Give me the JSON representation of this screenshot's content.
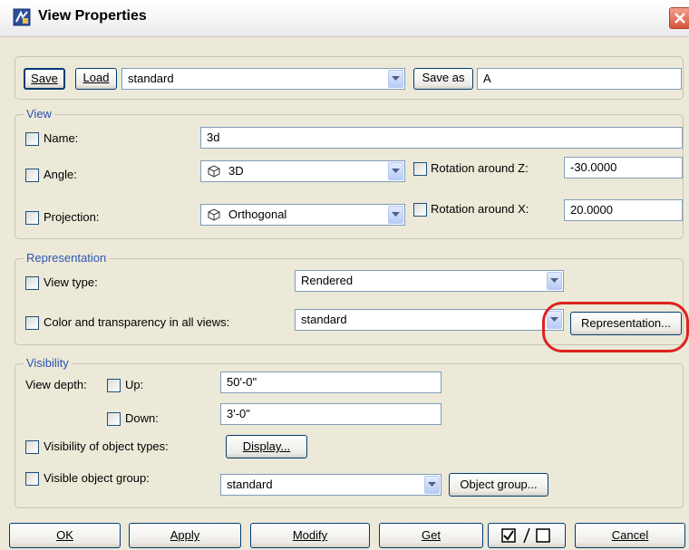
{
  "window": {
    "title": "View Properties"
  },
  "toolbar": {
    "save_label": "Save",
    "load_label": "Load",
    "preset_value": "standard",
    "save_as_label": "Save as",
    "save_as_value": "A"
  },
  "view": {
    "legend": "View",
    "name_label": "Name:",
    "name_value": "3d",
    "angle_label": "Angle:",
    "angle_value": "3D",
    "rot_z_label": "Rotation around Z:",
    "rot_z_value": "-30.0000",
    "projection_label": "Projection:",
    "projection_value": "Orthogonal",
    "rot_x_label": "Rotation around X:",
    "rot_x_value": "20.0000"
  },
  "representation": {
    "legend": "Representation",
    "view_type_label": "View type:",
    "view_type_value": "Rendered",
    "color_label": "Color and transparency in all views:",
    "color_value": "standard",
    "representation_button": "Representation..."
  },
  "visibility": {
    "legend": "Visibility",
    "view_depth_label": "View depth:",
    "up_label": "Up:",
    "up_value": "50'-0\"",
    "down_label": "Down:",
    "down_value": "3'-0\"",
    "object_types_label": "Visibility of object types:",
    "display_button": "Display...",
    "object_group_label": "Visible object group:",
    "object_group_value": "standard",
    "object_group_button": "Object group..."
  },
  "footer": {
    "ok": "OK",
    "apply": "Apply",
    "modify": "Modify",
    "get": "Get",
    "cancel": "Cancel"
  },
  "icons": {
    "app": "view-properties-icon",
    "close": "close-icon",
    "dropdown": "chevron-down-icon",
    "cube": "cube-icon",
    "toggle": "check-toggle-icon"
  },
  "colors": {
    "legend": "#2a54b4",
    "highlight": "#e02020",
    "dialog_bg": "#ece9d8"
  }
}
